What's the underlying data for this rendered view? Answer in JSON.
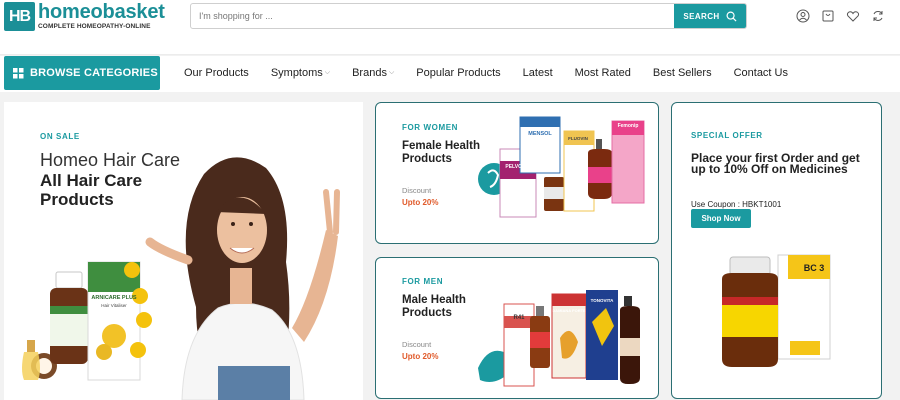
{
  "header": {
    "logo_mark": "HB",
    "logo_title": "homeobasket",
    "logo_subtitle": "COMPLETE HOMEOPATHY-ONLINE",
    "search_placeholder": "I'm shopping for ...",
    "search_button": "SEARCH",
    "icons": [
      "user-icon",
      "cart-icon",
      "heart-icon",
      "refresh-icon"
    ]
  },
  "nav": {
    "browse_label": "BROWSE CATEGORIES",
    "links": [
      {
        "label": "Our Products",
        "dropdown": false
      },
      {
        "label": "Symptoms",
        "dropdown": true
      },
      {
        "label": "Brands",
        "dropdown": true
      },
      {
        "label": "Popular Products",
        "dropdown": false
      },
      {
        "label": "Latest",
        "dropdown": false
      },
      {
        "label": "Most Rated",
        "dropdown": false
      },
      {
        "label": "Best Sellers",
        "dropdown": false
      },
      {
        "label": "Contact Us",
        "dropdown": false
      }
    ]
  },
  "hero": {
    "tag": "ON SALE",
    "line1": "Homeo Hair Care",
    "line2": "All Hair Care Products",
    "product_name": "ARNICARE PLUS",
    "product_sub": "Hair Vitaliser"
  },
  "women_card": {
    "tag": "FOR WOMEN",
    "title": "Female Health Products",
    "discount_label": "Discount",
    "discount_value": "Upto 20%",
    "products": [
      "MENSOL",
      "FLUOVIN",
      "PELVORIN",
      "Femonip"
    ]
  },
  "men_card": {
    "tag": "FOR MEN",
    "title": "Male Health Products",
    "discount_label": "Discount",
    "discount_value": "Upto 20%",
    "products": [
      "R41",
      "DAMIANA FORTE",
      "TONOVITA"
    ]
  },
  "offer_card": {
    "tag": "SPECIAL OFFER",
    "title": "Place your first Order and get up to 10% Off on Medicines",
    "coupon": "Use Coupon : HBKT1001",
    "button": "Shop Now",
    "product": "BC 3"
  },
  "colors": {
    "brand": "#1b9aa0",
    "accent": "#e05a2a",
    "card_border": "#2b6f73"
  }
}
